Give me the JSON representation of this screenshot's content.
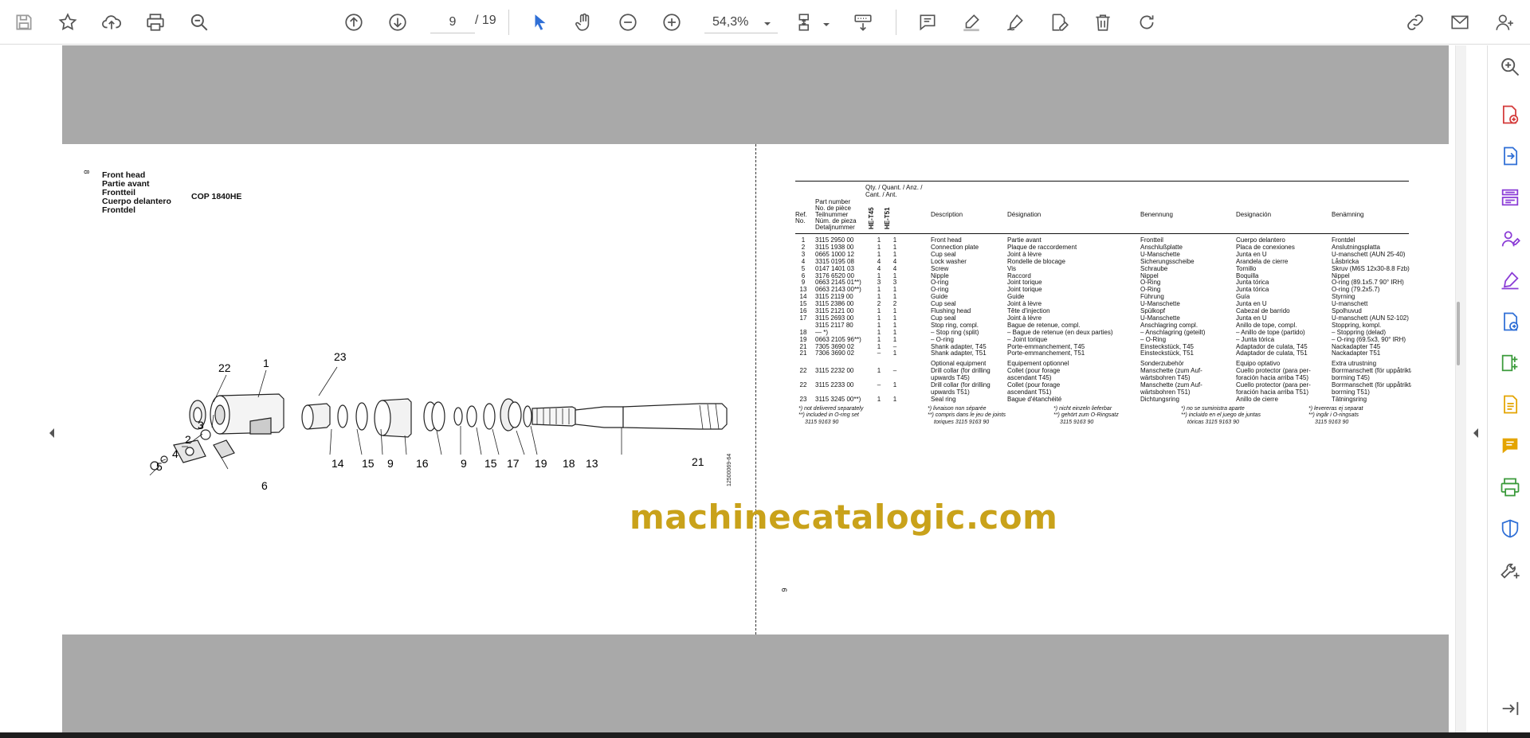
{
  "toolbar": {
    "page_current": "9",
    "page_total": "/ 19",
    "zoom": "54,3%",
    "icons": [
      "save-icon",
      "bookmark-star-icon",
      "upload-cloud-icon",
      "print-icon",
      "search-zoom-icon",
      "prev-page-icon",
      "next-page-icon",
      "select-arrow-icon",
      "hand-pan-icon",
      "zoom-out-icon",
      "zoom-in-icon",
      "fit-page-icon",
      "scroll-mode-icon",
      "comment-icon",
      "highlight-pen-icon",
      "sign-icon",
      "edit-pdf-icon",
      "delete-icon",
      "redo-icon",
      "share-link-icon",
      "email-icon",
      "user-icon"
    ]
  },
  "right_rail": {
    "icons": [
      "zoom-search-icon",
      "create-pdf-icon",
      "export-pdf-icon",
      "organize-pages-icon",
      "fill-sign-icon",
      "draw-sign-icon",
      "request-sign-icon",
      "compress-icon",
      "export-file-icon",
      "comment-icon",
      "print-production-icon",
      "protect-icon",
      "more-tools-icon",
      "collapse-panel-icon"
    ]
  },
  "left_page": {
    "page_number": "8",
    "title_lines": [
      "Front head",
      "Partie avant",
      "Frontteil",
      "Cuerpo delantero",
      "Frontdel"
    ],
    "model": "COP 1840HE",
    "drawing_code": "12500069-64",
    "callouts": [
      "22",
      "1",
      "23",
      "3",
      "2",
      "4",
      "5",
      "6",
      "14",
      "15",
      "9",
      "16",
      "9",
      "15",
      "17",
      "19",
      "18",
      "13",
      "21"
    ]
  },
  "right_page": {
    "page_number": "9",
    "header": {
      "qty": "Qty. / Quant. / Anz. /",
      "cant": "Cant. / Ant.",
      "ref": [
        "Ref.",
        "No."
      ],
      "part_number": [
        "Part number",
        "No. de pièce",
        "Teilnummer",
        "Núm. de pieza",
        "Detaljnummer"
      ],
      "he_t45": "HE-T45",
      "he_t51": "HE-T51",
      "description": "Description",
      "designation": "Désignation",
      "benennung": "Benennung",
      "designacion": "Designación",
      "benamning": "Benämning"
    },
    "rows": [
      {
        "ref": "1",
        "pn": "3115 2950 00",
        "q45": "1",
        "q51": "1",
        "en": "Front head",
        "fr": "Partie avant",
        "de": "Frontteil",
        "es": "Cuerpo delantero",
        "sv": "Frontdel"
      },
      {
        "ref": "2",
        "pn": "3115 1938 00",
        "q45": "1",
        "q51": "1",
        "en": "Connection plate",
        "fr": "Plaque de raccordement",
        "de": "Anschlußplatte",
        "es": "Placa de conexiones",
        "sv": "Anslutningsplatta"
      },
      {
        "ref": "3",
        "pn": "0665 1000 12",
        "q45": "1",
        "q51": "1",
        "en": "Cup seal",
        "fr": "Joint à lèvre",
        "de": "U-Manschette",
        "es": "Junta en U",
        "sv": "U-manschett (AUN 25-40)"
      },
      {
        "ref": "4",
        "pn": "3315 0195 08",
        "q45": "4",
        "q51": "4",
        "en": "Lock washer",
        "fr": "Rondelle de blocage",
        "de": "Sicherungsscheibe",
        "es": "Arandela de cierre",
        "sv": "Låsbricka"
      },
      {
        "ref": "5",
        "pn": "0147 1401 03",
        "q45": "4",
        "q51": "4",
        "en": "Screw",
        "fr": "Vis",
        "de": "Schraube",
        "es": "Tornillo",
        "sv": "Skruv (M6S 12x30-8.8 Fzb)"
      },
      {
        "ref": "6",
        "pn": "3176 6520 00",
        "q45": "1",
        "q51": "1",
        "en": "Nipple",
        "fr": "Raccord",
        "de": "Nippel",
        "es": "Boquilla",
        "sv": "Nippel"
      },
      {
        "ref": "9",
        "pn": "0663 2145 01**)",
        "q45": "3",
        "q51": "3",
        "en": "O-ring",
        "fr": "Joint torique",
        "de": "O-Ring",
        "es": "Junta tórica",
        "sv": "O-ring (89.1x5.7 90° IRH)"
      },
      {
        "ref": "13",
        "pn": "0663 2143 00**)",
        "q45": "1",
        "q51": "1",
        "en": "O-ring",
        "fr": "Joint torique",
        "de": "O-Ring",
        "es": "Junta tórica",
        "sv": "O-ring (79.2x5.7)"
      },
      {
        "ref": "14",
        "pn": "3115 2119 00",
        "q45": "1",
        "q51": "1",
        "en": "Guide",
        "fr": "Guide",
        "de": "Führung",
        "es": "Guía",
        "sv": "Styrning"
      },
      {
        "ref": "15",
        "pn": "3115 2386 00",
        "q45": "2",
        "q51": "2",
        "en": "Cup seal",
        "fr": "Joint à lèvre",
        "de": "U-Manschette",
        "es": "Junta en U",
        "sv": "U-manschett"
      },
      {
        "ref": "16",
        "pn": "3115 2121 00",
        "q45": "1",
        "q51": "1",
        "en": "Flushing head",
        "fr": "Tête d'injection",
        "de": "Spülkopf",
        "es": "Cabezal de barrido",
        "sv": "Spolhuvud"
      },
      {
        "ref": "17",
        "pn": "3115 2693 00",
        "q45": "1",
        "q51": "1",
        "en": "Cup seal",
        "fr": "Joint à lèvre",
        "de": "U-Manschette",
        "es": "Junta en U",
        "sv": "U-manschett (AUN 52-102)"
      },
      {
        "ref": "",
        "pn": "3115 2117 80",
        "q45": "1",
        "q51": "1",
        "en": "Stop ring, compl.",
        "fr": "Bague de retenue, compl.",
        "de": "Anschlagring compl.",
        "es": "Anillo de tope, compl.",
        "sv": "Stoppring, kompl."
      },
      {
        "ref": "18",
        "pn": "— *)",
        "q45": "1",
        "q51": "1",
        "en": "– Stop ring (split)",
        "fr": "– Bague de retenue (en deux parties)",
        "de": "– Anschlagring (geteilt)",
        "es": "– Anillo de tope (partido)",
        "sv": "– Stoppring (delad)"
      },
      {
        "ref": "19",
        "pn": "0663 2105 96**)",
        "q45": "1",
        "q51": "1",
        "en": "– O-ring",
        "fr": "– Joint torique",
        "de": "– O-Ring",
        "es": "– Junta tórica",
        "sv": "– O-ring (69.5x3, 90° IRH)"
      },
      {
        "ref": "21",
        "pn": "7305 3690 02",
        "q45": "1",
        "q51": "–",
        "en": "Shank adapter, T45",
        "fr": "Porte-emmanchement, T45",
        "de": "Einsteckstück, T45",
        "es": "Adaptador de culata, T45",
        "sv": "Nackadapter T45"
      },
      {
        "ref": "21",
        "pn": "7306 3690 02",
        "q45": "–",
        "q51": "1",
        "en": "Shank adapter, T51",
        "fr": "Porte-emmanchement, T51",
        "de": "Einsteckstück, T51",
        "es": "Adaptador de culata, T51",
        "sv": "Nackadapter T51"
      }
    ],
    "optional": {
      "heading": {
        "en": "Optional equipment",
        "fr": "Equipement optionnel",
        "de": "Sonderzubehör",
        "es": "Equipo optativo",
        "sv": "Extra utrustning"
      },
      "rows": [
        {
          "ref": "22",
          "pn": "3115 2232 00",
          "q45": "1",
          "q51": "–",
          "en": [
            "Drill collar (for drilling",
            "upwards T45)"
          ],
          "fr": [
            "Collet (pour forage",
            "ascendant T45)"
          ],
          "de": [
            "Manschette (zum Auf-",
            "wärtsbohren T45)"
          ],
          "es": [
            "Cuello protector (para per-",
            "foración hacia arriba T45)"
          ],
          "sv": [
            "Borrmanschett (för uppåtriktad",
            "borrning T45)"
          ]
        },
        {
          "ref": "22",
          "pn": "3115 2233 00",
          "q45": "–",
          "q51": "1",
          "en": [
            "Drill collar (for drilling",
            "upwards T51)"
          ],
          "fr": [
            "Collet (pour forage",
            "ascendant T51)"
          ],
          "de": [
            "Manschette (zum Auf-",
            "wärtsbohren T51)"
          ],
          "es": [
            "Cuello protector (para per-",
            "foración hacia arriba T51)"
          ],
          "sv": [
            "Borrmanschett (för uppåtriktad",
            "borrning T51)"
          ]
        },
        {
          "ref": "23",
          "pn": "3115 3245 00**)",
          "q45": "1",
          "q51": "1",
          "en": [
            "Seal ring"
          ],
          "fr": [
            "Bague d'étanchéité"
          ],
          "de": [
            "Dichtungsring"
          ],
          "es": [
            "Anillo de cierre"
          ],
          "sv": [
            "Tätningsring"
          ]
        }
      ]
    },
    "footnotes": {
      "en": [
        "*) not delivered separately",
        "**) included in O-ring set",
        "3115 9163 90"
      ],
      "fr": [
        "*) livraison non séparée",
        "**) compris dans le jeu de joints",
        "toriques 3115 9163 90"
      ],
      "de": [
        "*) nicht einzeln lieferbar",
        "**) gehört zum O-Ringsatz",
        "3115 9163 90"
      ],
      "es": [
        "*) no se suministra aparte",
        "**) incluido en el juego de juntas",
        "tóricas 3115 9163 90"
      ],
      "sv": [
        "*) levereras ej separat",
        "**) ingår i O-ringsats",
        "3115 9163 90"
      ]
    }
  },
  "watermark": "machinecatalogic.com",
  "colors": {
    "accent_blue": "#2f6fd6",
    "accent_purple": "#8a3bd6",
    "accent_red": "#d43a3a",
    "accent_green": "#3a9a3a",
    "accent_yellow": "#e4a400",
    "canvas_gray": "#a9a9a9",
    "watermark_gold": "#c9a21a"
  }
}
